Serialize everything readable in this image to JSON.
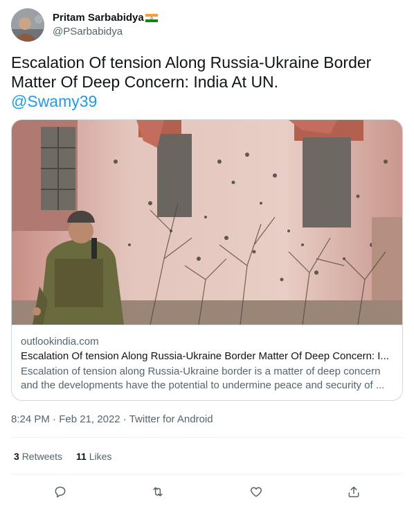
{
  "author": {
    "display_name": "Pritam Sarbabidya",
    "handle": "@PSarbabidya"
  },
  "tweet": {
    "text": "Escalation Of tension Along Russia-Ukraine Border Matter Of Deep Concern: India At UN.",
    "mention": "@Swamy39"
  },
  "card": {
    "domain": "outlookindia.com",
    "title": "Escalation Of tension Along Russia-Ukraine Border Matter Of Deep Concern: I...",
    "description_line1": "Escalation of tension along Russia-Ukraine border is a matter of deep concern",
    "description_line2": "and the developments have the potential to undermine peace and security of ..."
  },
  "meta": {
    "time": "8:24 PM",
    "date": "Feb 21, 2022",
    "source": "Twitter for Android"
  },
  "stats": {
    "retweets_count": "3",
    "retweets_label": "Retweets",
    "likes_count": "11",
    "likes_label": "Likes"
  },
  "icons": {
    "reply": "reply-icon",
    "retweet": "retweet-icon",
    "like": "heart-icon",
    "share": "share-icon"
  },
  "colors": {
    "link": "#1d9bf0",
    "secondary_text": "#536471",
    "primary_text": "#0f1419",
    "border": "#cfd9de"
  }
}
